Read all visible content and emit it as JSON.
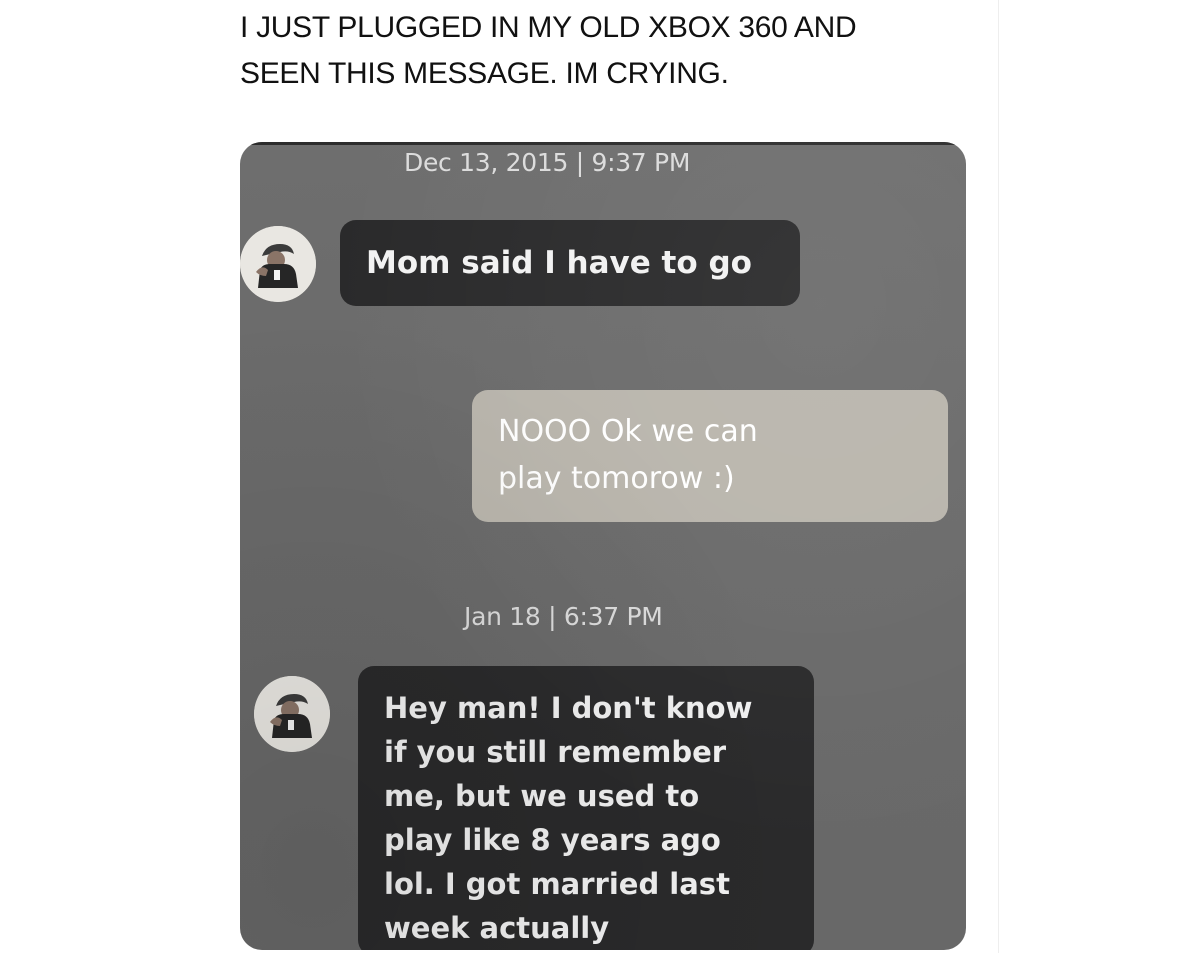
{
  "post": {
    "caption_lines": [
      "I JUST PLUGGED IN MY OLD XBOX 360 AND",
      "SEEN THIS MESSAGE. IM CRYING."
    ]
  },
  "conversation": {
    "timestamps": [
      "Dec 13, 2015 | 9:37 PM",
      "Jan 18 | 6:37 PM"
    ],
    "messages": [
      {
        "sender": "friend",
        "avatar_icon": "gamer-avatar-icon",
        "lines": [
          "Mom said I have to go"
        ]
      },
      {
        "sender": "me",
        "lines": [
          "NOOO Ok we can",
          "play tomorow :)"
        ]
      },
      {
        "sender": "friend",
        "avatar_icon": "gamer-avatar-icon",
        "lines": [
          "Hey man! I don't know",
          "if you still remember",
          "me, but we used to",
          "play like 8 years ago",
          "lol. I got married last",
          "week actually"
        ]
      }
    ]
  },
  "colors": {
    "screen_bg": "#6b6b6b",
    "incoming_bubble": "#2a2a2b",
    "outgoing_bubble": "#b9b5ac",
    "timestamp_text": "#dcdcdc"
  }
}
